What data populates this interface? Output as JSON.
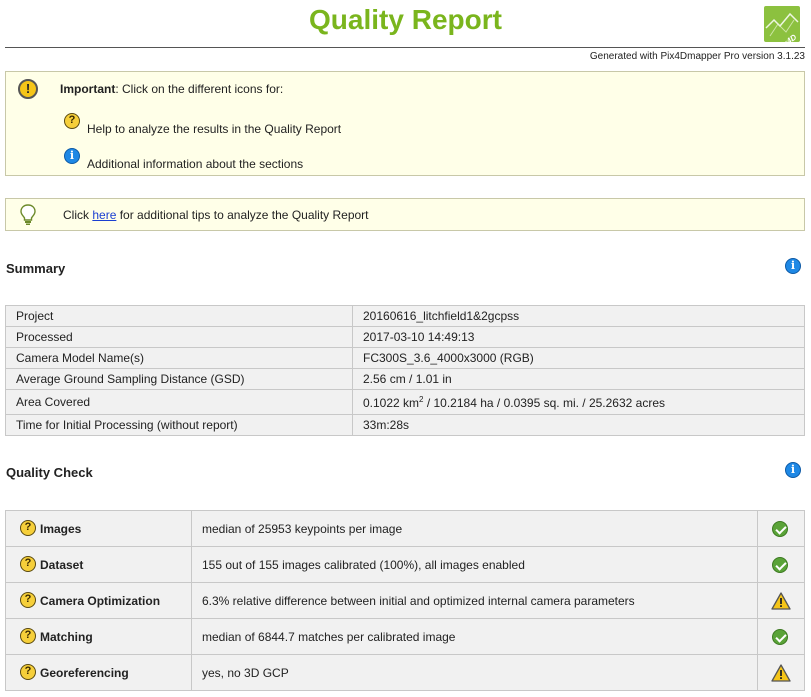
{
  "header": {
    "title": "Quality Report",
    "generated": "Generated with Pix4Dmapper Pro version 3.1.23",
    "logo_text": "Pix4D"
  },
  "notice": {
    "important_label": "Important",
    "important_text": ": Click on the different icons for:",
    "help_text": "Help to analyze the results in the Quality Report",
    "info_text": "Additional information about the sections"
  },
  "tips": {
    "before": "Click ",
    "link": "here",
    "after": " for additional tips to analyze the Quality Report"
  },
  "summary": {
    "title": "Summary",
    "rows": [
      {
        "key": "Project",
        "value": "20160616_litchfield1&2gcpss"
      },
      {
        "key": "Processed",
        "value": "2017-03-10 14:49:13"
      },
      {
        "key": "Camera Model Name(s)",
        "value": "FC300S_3.6_4000x3000 (RGB)"
      },
      {
        "key": "Average Ground Sampling Distance (GSD)",
        "value": "2.56 cm / 1.01 in"
      },
      {
        "key": "Area Covered",
        "value_prefix": "0.1022 km",
        "value_sup": "2",
        "value_suffix": " / 10.2184 ha / 0.0395 sq. mi. / 25.2632 acres"
      },
      {
        "key": "Time for Initial Processing (without report)",
        "value": "33m:28s"
      }
    ]
  },
  "quality_check": {
    "title": "Quality Check",
    "rows": [
      {
        "key": "Images",
        "value": "median of 25953 keypoints per image",
        "status": "ok"
      },
      {
        "key": "Dataset",
        "value": "155 out of 155 images calibrated (100%), all images enabled",
        "status": "ok"
      },
      {
        "key": "Camera Optimization",
        "value": "6.3% relative difference between initial and optimized internal camera parameters",
        "status": "warning"
      },
      {
        "key": "Matching",
        "value": "median of 6844.7 matches per calibrated image",
        "status": "ok"
      },
      {
        "key": "Georeferencing",
        "value": "yes, no 3D GCP",
        "status": "warning"
      }
    ]
  },
  "icons": {
    "important": "exclamation-icon",
    "help": "question-icon",
    "info": "info-icon",
    "tip": "lightbulb-icon",
    "ok": "check-icon",
    "warning": "warning-triangle-icon"
  },
  "colors": {
    "title": "#7ab51d",
    "notice_bg": "#ffffe8",
    "table_bg": "#f1f1f1",
    "ok": "#5aa338",
    "warning": "#f5c518",
    "info": "#1e88e5"
  }
}
